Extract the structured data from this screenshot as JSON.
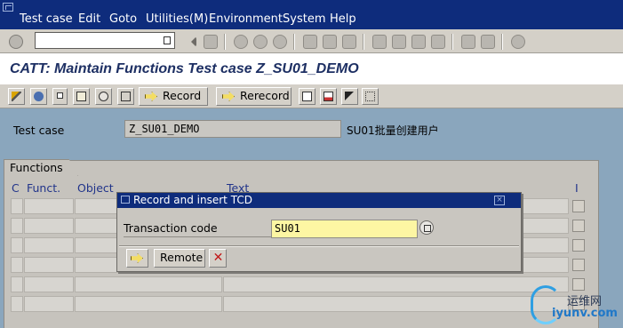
{
  "menubar": {
    "items": [
      {
        "label": "Test case",
        "underline": "T"
      },
      {
        "label": "Edit",
        "underline": "E"
      },
      {
        "label": "Goto",
        "underline": "G"
      },
      {
        "label": "Utilities(M)",
        "underline": "U"
      },
      {
        "label": "Environment",
        "underline": "n"
      },
      {
        "label": "System",
        "underline": "S"
      },
      {
        "label": "Help",
        "underline": "H"
      }
    ]
  },
  "toolbar": {
    "command_field_value": "",
    "icons": [
      "enter-icon",
      "back-icon",
      "save-icon",
      "back-nav-icon",
      "exit-icon",
      "cancel-icon",
      "print-icon",
      "find-icon",
      "find-next-icon",
      "first-page-icon",
      "previous-page-icon",
      "next-page-icon",
      "last-page-icon",
      "create-session-icon",
      "shortcut-icon",
      "help-icon"
    ]
  },
  "screen": {
    "title": "CATT: Maintain Functions Test case Z_SU01_DEMO"
  },
  "app_toolbar": {
    "record_label": "Record",
    "rerecord_label": "Rerecord"
  },
  "form": {
    "test_case_label": "Test case",
    "test_case_value": "Z_SU01_DEMO",
    "test_case_desc": "SU01批量创建用户"
  },
  "functions": {
    "tab_label": "Functions",
    "columns": {
      "c": "C",
      "funct": "Funct.",
      "object": "Object",
      "text": "Text",
      "i": "I"
    },
    "row_count": 6
  },
  "dialog": {
    "title": "Record and insert TCD",
    "transaction_code_label": "Transaction code",
    "transaction_code_value": "SU01",
    "remote_label": "Remote"
  },
  "watermark": {
    "cn": "运维网",
    "url": "iyunv.com"
  }
}
